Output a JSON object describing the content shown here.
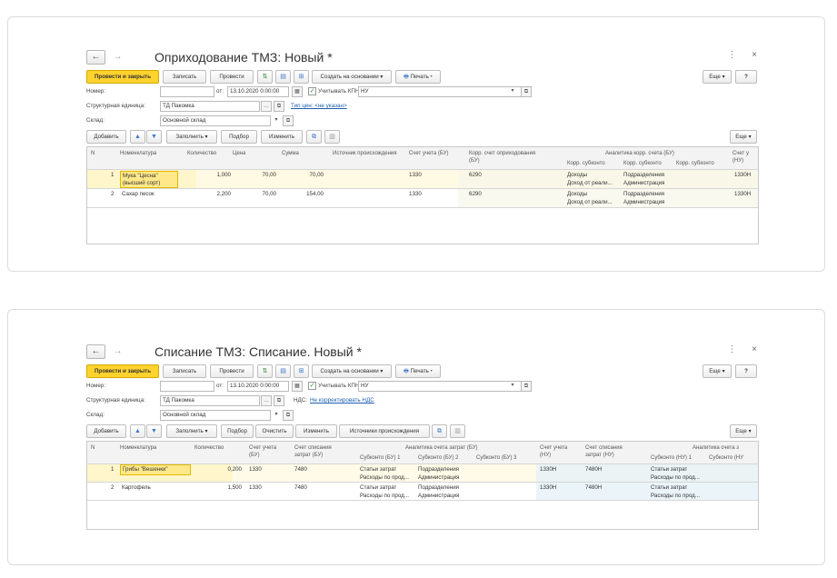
{
  "receipt": {
    "title": "Оприходование ТМЗ: Новый *",
    "nav": {
      "back": "←",
      "forward": "→"
    },
    "window_icons": {
      "more": "⋮",
      "close": "×"
    },
    "toolbar": {
      "post_close": "Провести и закрыть",
      "save": "Записать",
      "post": "Провести",
      "create_based": "Создать на основании ▾",
      "print": "Печать ▾",
      "more": "Еще ▾",
      "help": "?"
    },
    "form": {
      "number_label": "Номер:",
      "number_value": "",
      "date_label": "от:",
      "date_value": "13.10.2020  0:00:00",
      "kpn_label": "Учитывать КПН",
      "kpn_value": "НУ",
      "unit_label": "Структурная единица:",
      "unit_value": "ТД Пакомка",
      "price_type_link": "Тип цен: <не указан>",
      "warehouse_label": "Склад:",
      "warehouse_value": "Основной склад"
    },
    "table_toolbar": {
      "add": "Добавить",
      "fill": "Заполнить ▾",
      "pick": "Подбор",
      "change": "Изменить",
      "more": "Еще ▾"
    },
    "table": {
      "headers": {
        "n": "N",
        "item": "Номенклатура",
        "qty": "Количество",
        "price": "Цена",
        "sum": "Сумма",
        "source": "Источник происхождения",
        "account_bu": "Счет учета (БУ)",
        "corr_account": "Корр. счет оприходования (БУ)",
        "analytics_group": "Аналитика корр. счета (БУ)",
        "corr_sub1": "Корр. субконто",
        "corr_sub2": "Корр. субконто",
        "corr_sub3": "Корр. субконто",
        "account_nu": "Счет у (НУ)"
      },
      "rows": [
        {
          "n": "1",
          "item": "Мука \"Цесна\"",
          "item2": "(высший сорт)",
          "qty": "1,000",
          "price": "70,00",
          "sum": "70,00",
          "account_bu": "1330",
          "corr": "6290",
          "s1a": "Доходы",
          "s1b": "Доход от реали...",
          "s2a": "Подразделения",
          "s2b": "Администрация",
          "nu": "1330Н"
        },
        {
          "n": "2",
          "item": "Сахар песок",
          "item2": "",
          "qty": "2,200",
          "price": "70,00",
          "sum": "154,00",
          "account_bu": "1330",
          "corr": "6290",
          "s1a": "Доходы",
          "s1b": "Доход от реали...",
          "s2a": "Подразделения",
          "s2b": "Администрация",
          "nu": "1330Н"
        }
      ]
    }
  },
  "writeoff": {
    "title": "Списание ТМЗ: Списание. Новый *",
    "nav": {
      "back": "←",
      "forward": "→"
    },
    "window_icons": {
      "more": "⋮",
      "close": "×"
    },
    "toolbar": {
      "post_close": "Провести и закрыть",
      "save": "Записать",
      "post": "Провести",
      "create_based": "Создать на основании ▾",
      "print": "Печать ▾",
      "more": "Еще ▾",
      "help": "?"
    },
    "form": {
      "number_label": "Номер:",
      "number_value": "",
      "date_label": "от:",
      "date_value": "13.10.2020  0:00:00",
      "kpn_label": "Учитывать КПН",
      "kpn_value": "НУ",
      "unit_label": "Структурная единица:",
      "unit_value": "ТД Пакомка",
      "vat_label": "НДС:",
      "vat_link": "Не корректировать НДС",
      "warehouse_label": "Склад:",
      "warehouse_value": "Основной склад"
    },
    "table_toolbar": {
      "add": "Добавить",
      "fill": "Заполнить ▾",
      "pick": "Подбор",
      "clear": "Очистить",
      "change": "Изменить",
      "sources": "Источники происхождения",
      "more": "Еще ▾"
    },
    "table": {
      "headers": {
        "n": "N",
        "item": "Номенклатура",
        "qty": "Количество",
        "account_bu": "Счет учета (БУ)",
        "writeoff_bu": "Счет списания затрат (БУ)",
        "analytics_bu": "Аналитика счета затрат (БУ)",
        "sub_bu1": "Субконто (БУ) 1",
        "sub_bu2": "Субконто (БУ) 2",
        "sub_bu3": "Субконто (БУ) 3",
        "account_nu": "Счет учета (НУ)",
        "writeoff_nu": "Счет списания затрат (НУ)",
        "analytics_nu": "Аналитика счета з",
        "sub_nu1": "Субконто (НУ) 1",
        "sub_nu2": "Субконто (НУ"
      },
      "rows": [
        {
          "n": "1",
          "item": "Грибы \"Вешенки\"",
          "qty": "0,200",
          "account_bu": "1330",
          "writeoff_bu": "7480",
          "s1a": "Статьи затрат",
          "s1b": "Расходы по прод...",
          "s2a": "Подразделения",
          "s2b": "Администрация",
          "nu": "1330Н",
          "writeoff_nu": "7480Н",
          "n1a": "Статьи затрат",
          "n1b": "Расходы по прод..."
        },
        {
          "n": "2",
          "item": "Картофель",
          "qty": "1,500",
          "account_bu": "1330",
          "writeoff_bu": "7480",
          "s1a": "Статьи затрат",
          "s1b": "Расходы по прод...",
          "s2a": "Подразделения",
          "s2b": "Администрация",
          "nu": "1330Н",
          "writeoff_nu": "7480Н",
          "n1a": "Статьи затрат",
          "n1b": "Расходы по прод..."
        }
      ]
    }
  },
  "colors": {
    "accent": "#ffd22e",
    "selected_row": "#fff6cc",
    "link": "#1f5fb0",
    "column_tint": "#f7f7ea"
  }
}
